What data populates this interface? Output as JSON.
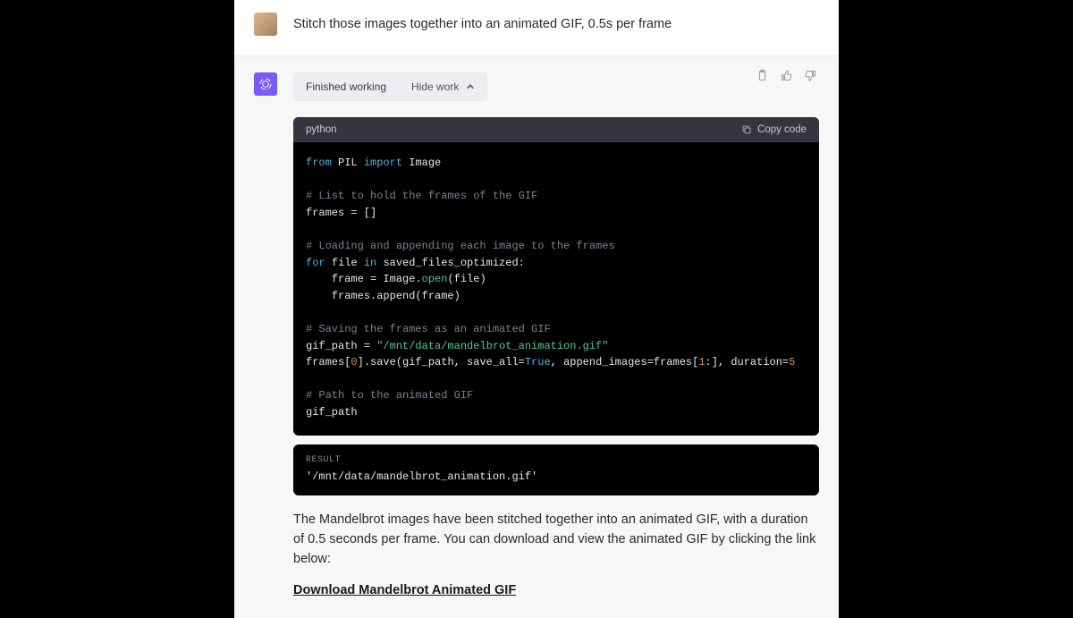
{
  "user": {
    "message": "Stitch those images together into an animated GIF, 0.5s per frame"
  },
  "assistant": {
    "work_status": "Finished working",
    "work_toggle": "Hide work",
    "code": {
      "language": "python",
      "copy_label": "Copy code",
      "tokens": {
        "from": "from",
        "pil": "PIL",
        "import": "import",
        "image": "Image",
        "cmt1": "# List to hold the frames of the GIF",
        "frames_eq": "frames = []",
        "cmt2": "# Loading and appending each image to the frames",
        "for": "for",
        "file": "file",
        "in": "in",
        "saved": "saved_files_optimized:",
        "frame_eq": "    frame = Image.",
        "open": "open",
        "open_tail": "(file)",
        "append": "    frames.append(frame)",
        "cmt3": "# Saving the frames as an animated GIF",
        "gif_eq": "gif_path = ",
        "gif_str": "\"/mnt/data/mandelbrot_animation.gif\"",
        "save_pre": "frames[",
        "zero": "0",
        "save_mid": "].save(gif_path, save_all=",
        "true": "True",
        "save_mid2": ", append_images=frames[",
        "one": "1",
        "save_tail": ":], duration=",
        "five": "5",
        "cmt4": "# Path to the animated GIF",
        "gif_path": "gif_path"
      }
    },
    "result": {
      "label": "RESULT",
      "value": "'/mnt/data/mandelbrot_animation.gif'"
    },
    "response": "The Mandelbrot images have been stitched together into an animated GIF, with a duration of 0.5 seconds per frame. You can download and view the animated GIF by clicking the link below:",
    "download_label": "Download Mandelbrot Animated GIF"
  }
}
